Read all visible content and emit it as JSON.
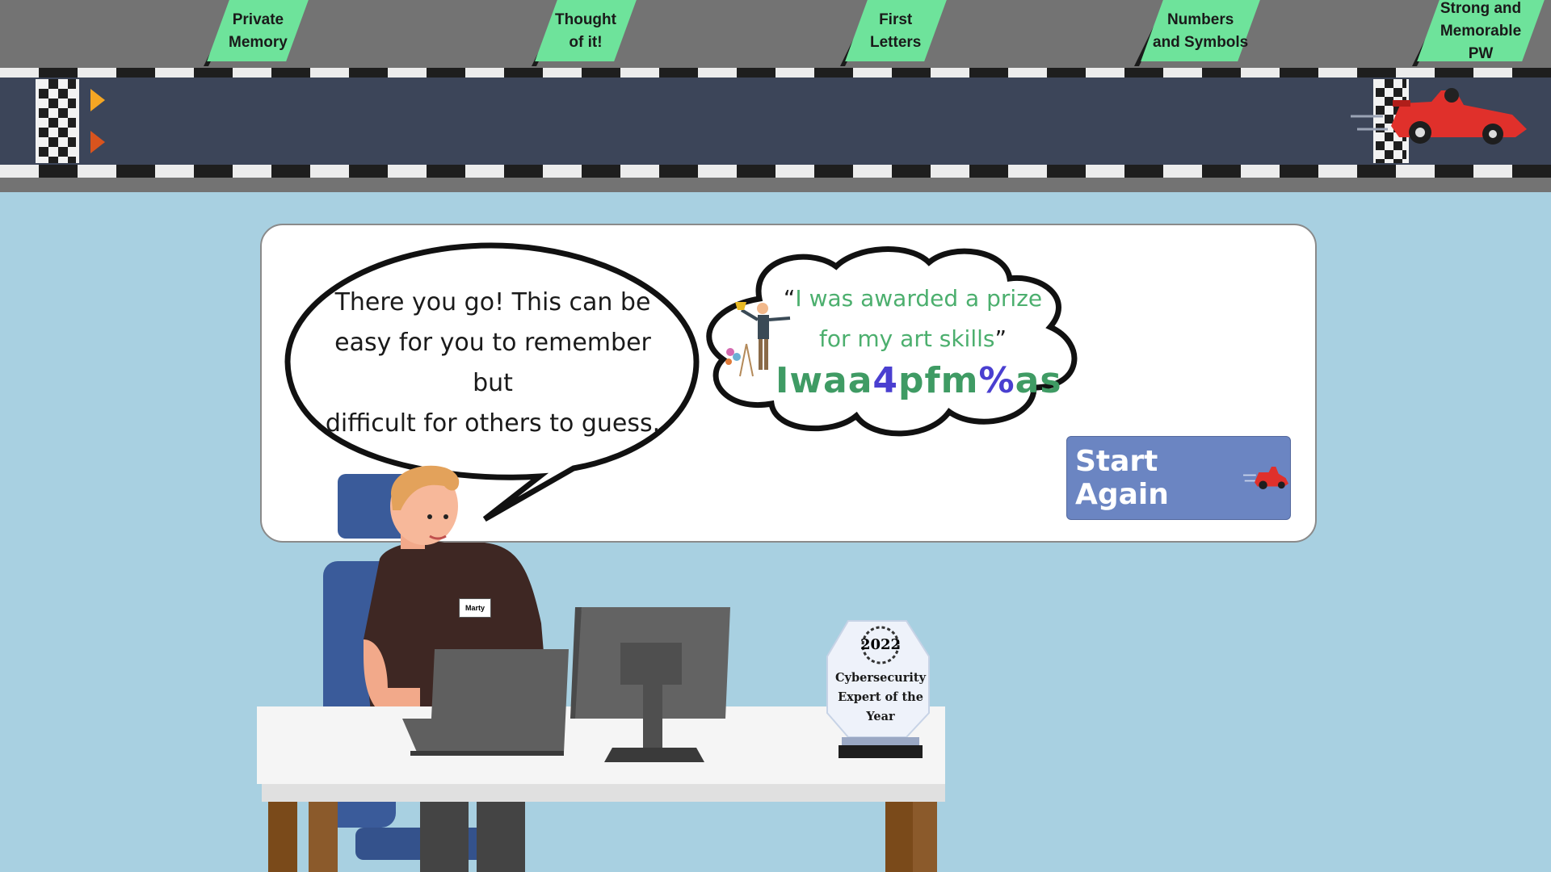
{
  "progress_steps": [
    {
      "label": "Private\nMemory"
    },
    {
      "label": "Thought\nof it!"
    },
    {
      "label": "First\nLetters"
    },
    {
      "label": "Numbers\nand Symbols"
    },
    {
      "label": "Strong and\nMemorable PW"
    }
  ],
  "speech": {
    "text": "There you go! This can be\neasy for you to remember but\ndifficult for others to guess."
  },
  "thought": {
    "open_quote": "“",
    "words": [
      "I",
      "was",
      "awarded",
      "a",
      "prize",
      "for",
      "my",
      "art",
      "skills"
    ],
    "close_quote": "”",
    "password_parts": [
      {
        "text": "Iwaa",
        "type": "letters"
      },
      {
        "text": "4",
        "type": "symbol"
      },
      {
        "text": "pfm",
        "type": "letters"
      },
      {
        "text": "%",
        "type": "symbol"
      },
      {
        "text": "as",
        "type": "letters"
      }
    ]
  },
  "start_again_button": {
    "label": "Start Again"
  },
  "character": {
    "name_tag": "Marty"
  },
  "trophy": {
    "year": "2022",
    "label": "Cybersecurity\nExpert of the\nYear"
  },
  "colors": {
    "flag_green": "#6ee39b",
    "road": "#3c4559",
    "background": "#a8d0e1",
    "button": "#6b85c2",
    "highlight_green": "#4caf6e",
    "symbol_purple": "#4a3fd0"
  },
  "icons": [
    "checkered-flag-icon",
    "race-car-icon",
    "trophy-icon",
    "laptop-icon",
    "monitor-icon"
  ]
}
